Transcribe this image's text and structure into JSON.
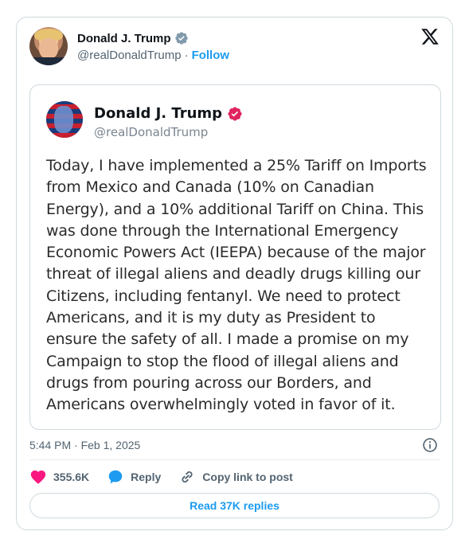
{
  "tweet": {
    "author_name": "Donald J. Trump",
    "author_handle": "@realDonaldTrump",
    "separator": "·",
    "follow_label": "Follow",
    "timestamp": "5:44 PM · Feb 1, 2025",
    "likes": "355.6K",
    "reply_label": "Reply",
    "copy_label": "Copy link to post",
    "read_replies_label": "Read 37K replies"
  },
  "embedded_post": {
    "author_name": "Donald J. Trump",
    "author_handle": "@realDonaldTrump",
    "text": "Today, I have implemented a 25% Tariff on Imports from Mexico and Canada (10% on Canadian Energy), and a 10% additional Tariff on China. This was done through the International Emergency Economic Powers Act (IEEPA) because of the major threat of illegal aliens and deadly drugs killing our Citizens, including fentanyl. We need to protect Americans, and it is my duty as President to ensure the safety of all. I made a promise on my Campaign to stop the flood of illegal aliens and drugs from pouring across our Borders, and Americans overwhelmingly voted in favor of it."
  },
  "colors": {
    "accent": "#1d9bf0",
    "like": "#f91880",
    "verified_blue": "#1d9bf0",
    "verified_pink": "#e0245e",
    "muted_text": "#536471"
  },
  "icons": {
    "verified": "verified-badge-icon",
    "x_logo": "x-logo-icon",
    "info": "info-icon",
    "heart": "heart-icon",
    "reply": "speech-bubble-icon",
    "link": "link-icon"
  }
}
